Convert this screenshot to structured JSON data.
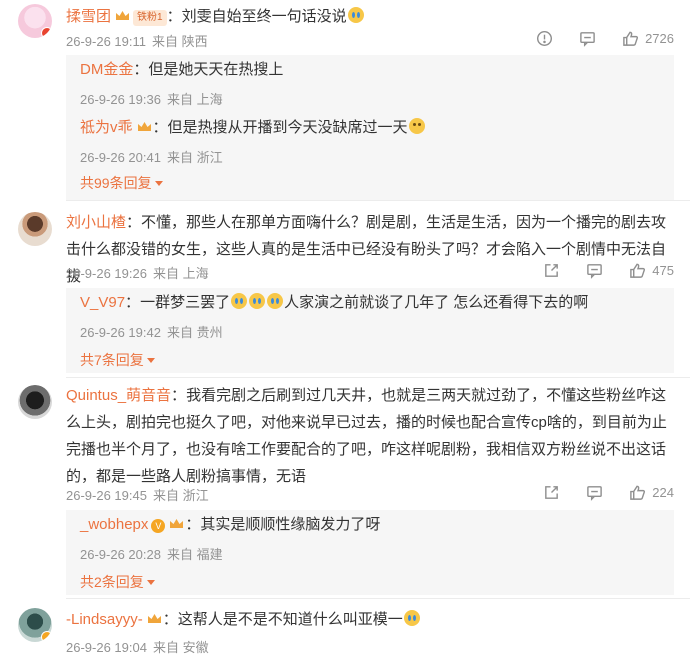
{
  "comments": [
    {
      "username": "揉雪团",
      "fan_badge": "铁粉1",
      "text": "刘雯自始至终一句话没说",
      "date": "26-9-26 19:11",
      "source": "来自 陕西",
      "likes": "2726",
      "replies": [
        {
          "username": "DM金金",
          "text": "但是她天天在热搜上",
          "date": "26-9-26 19:36",
          "source": "来自 上海"
        },
        {
          "username": "祗为v乖",
          "text": "但是热搜从开播到今天没缺席过一天",
          "date": "26-9-26 20:41",
          "source": "来自 浙江"
        }
      ],
      "more": "共99条回复"
    },
    {
      "username": "刘小山楂",
      "text": "不懂，那些人在那单方面嗨什么？剧是剧，生活是生活，因为一个播完的剧去攻击什么都没错的女生，这些人真的是生活中已经没有盼头了吗？才会陷入一个剧情中无法自拔",
      "date": "26-9-26 19:26",
      "source": "来自 上海",
      "likes": "475",
      "replies": [
        {
          "username": "V_V97",
          "text_a": "一群梦三罢了",
          "text_b": "人家演之前就谈了几年了 怎么还看得下去的啊",
          "date": "26-9-26 19:42",
          "source": "来自 贵州"
        }
      ],
      "more": "共7条回复"
    },
    {
      "username": "Quintus_萌音音",
      "text": "我看完剧之后刷到过几天井，也就是三两天就过劲了，不懂这些粉丝咋这么上头，剧拍完也挺久了吧，对他来说早已过去，播的时候也配合宣传cp啥的，到目前为止完播也半个月了，也没有啥工作要配合的了吧，咋这样呢剧粉，我相信双方粉丝说不出这话的，都是一些路人剧粉搞事情，无语",
      "date": "26-9-26 19:45",
      "source": "来自 浙江",
      "likes": "224",
      "replies": [
        {
          "username": "_wobhepx",
          "text": "其实是顺顺性缘脑发力了呀",
          "date": "26-9-26 20:28",
          "source": "来自 福建"
        }
      ],
      "more": "共2条回复"
    },
    {
      "username": "-Lindsayyy-",
      "text": "这帮人是不是不知道什么叫亚模一",
      "date": "26-9-26 19:04",
      "source": "来自 安徽"
    }
  ],
  "colors": {
    "username": "#eb7340",
    "meta": "#939393",
    "reply_bg": "#f6f6f6"
  },
  "icons": [
    "report-icon",
    "comment-icon",
    "share-icon",
    "like-icon",
    "emoji-cry-icon",
    "fan-crown-icon"
  ]
}
